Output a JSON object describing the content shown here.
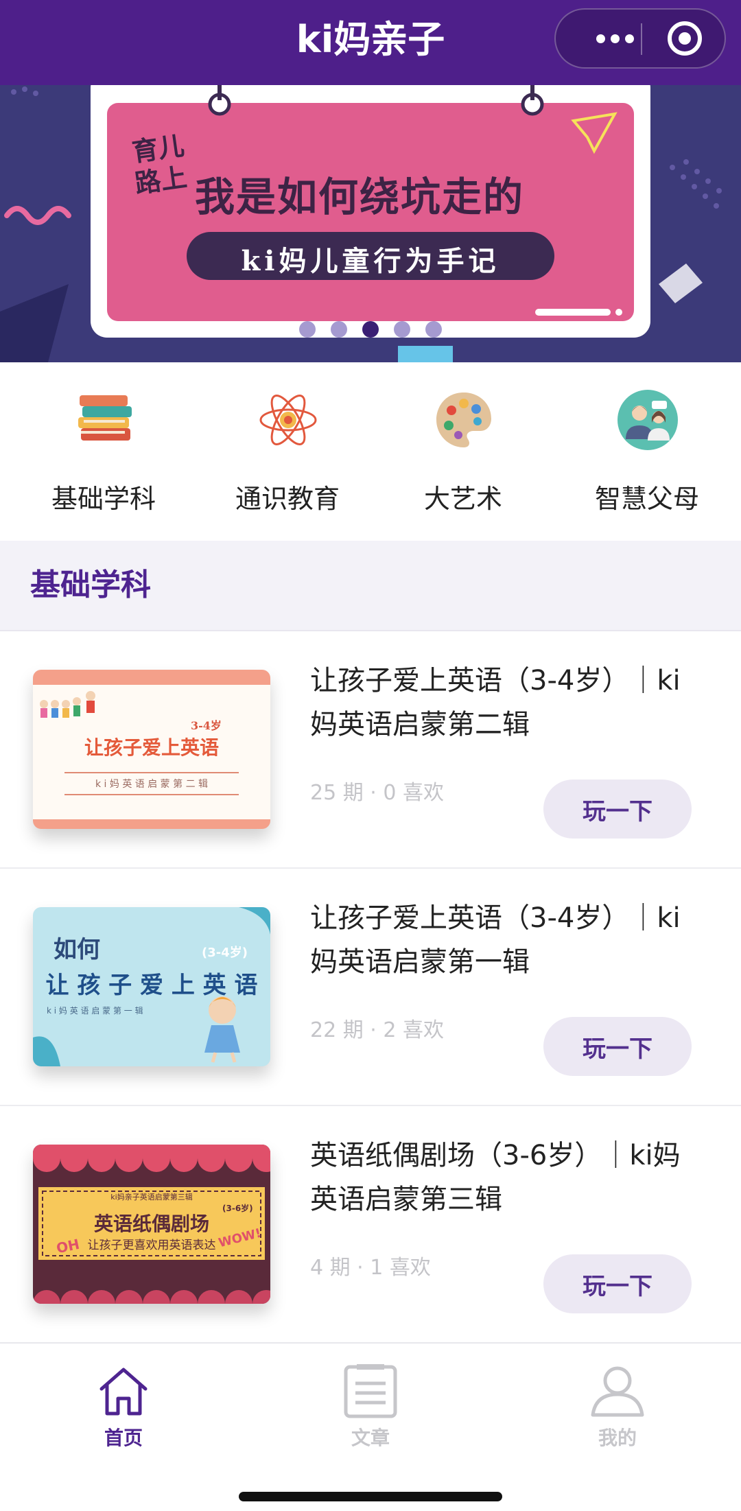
{
  "header": {
    "title": "ki妈亲子",
    "more_icon": "more-dots-icon",
    "close_icon": "target-circle-icon"
  },
  "banner": {
    "line1": "育儿",
    "line2": "路上",
    "headline": "我是如何绕坑走的",
    "pill": "ki妈儿童行为手记",
    "slide_count": 5,
    "active_slide_index": 2,
    "colors": {
      "background": "#3c3a79",
      "card": "#e05d8e",
      "pill": "#3c2a52"
    }
  },
  "categories": [
    {
      "label": "基础学科",
      "icon": "books-icon"
    },
    {
      "label": "通识教育",
      "icon": "atom-icon"
    },
    {
      "label": "大艺术",
      "icon": "palette-icon"
    },
    {
      "label": "智慧父母",
      "icon": "parents-icon"
    }
  ],
  "section": {
    "title": "基础学科"
  },
  "courses": [
    {
      "title": "让孩子爱上英语（3-4岁）｜ki妈英语启蒙第二辑",
      "meta": "25 期 · 0 喜欢",
      "button": "玩一下",
      "thumb": {
        "age": "3-4岁",
        "main": "让孩子爱上英语",
        "sub": "k i 妈 英 语 启 蒙 第 二 辑"
      }
    },
    {
      "title": "让孩子爱上英语（3-4岁）｜ki妈英语启蒙第一辑",
      "meta": "22 期 · 2 喜欢",
      "button": "玩一下",
      "thumb": {
        "top": "如何",
        "age": "(3-4岁)",
        "main": "让 孩 子 爱 上 英 语",
        "sub": "k i 妈 英 语 启 蒙 第 一 辑"
      }
    },
    {
      "title": "英语纸偶剧场（3-6岁）｜ki妈英语启蒙第三辑",
      "meta": "4 期 · 1 喜欢",
      "button": "玩一下",
      "thumb": {
        "top": "ki妈亲子英语启蒙第三辑",
        "age": "(3-6岁)",
        "main": "英语纸偶剧场",
        "sub": "让孩子更喜欢用英语表达",
        "left_tag": "OH",
        "right_tag": "WOW!"
      }
    }
  ],
  "tabbar": {
    "items": [
      {
        "label": "首页",
        "icon": "home-icon",
        "active": true
      },
      {
        "label": "文章",
        "icon": "article-icon",
        "active": false
      },
      {
        "label": "我的",
        "icon": "profile-icon",
        "active": false
      }
    ],
    "active_color": "#4e2490",
    "inactive_color": "#c6c6ca"
  },
  "accent_color": "#4e1f8a"
}
